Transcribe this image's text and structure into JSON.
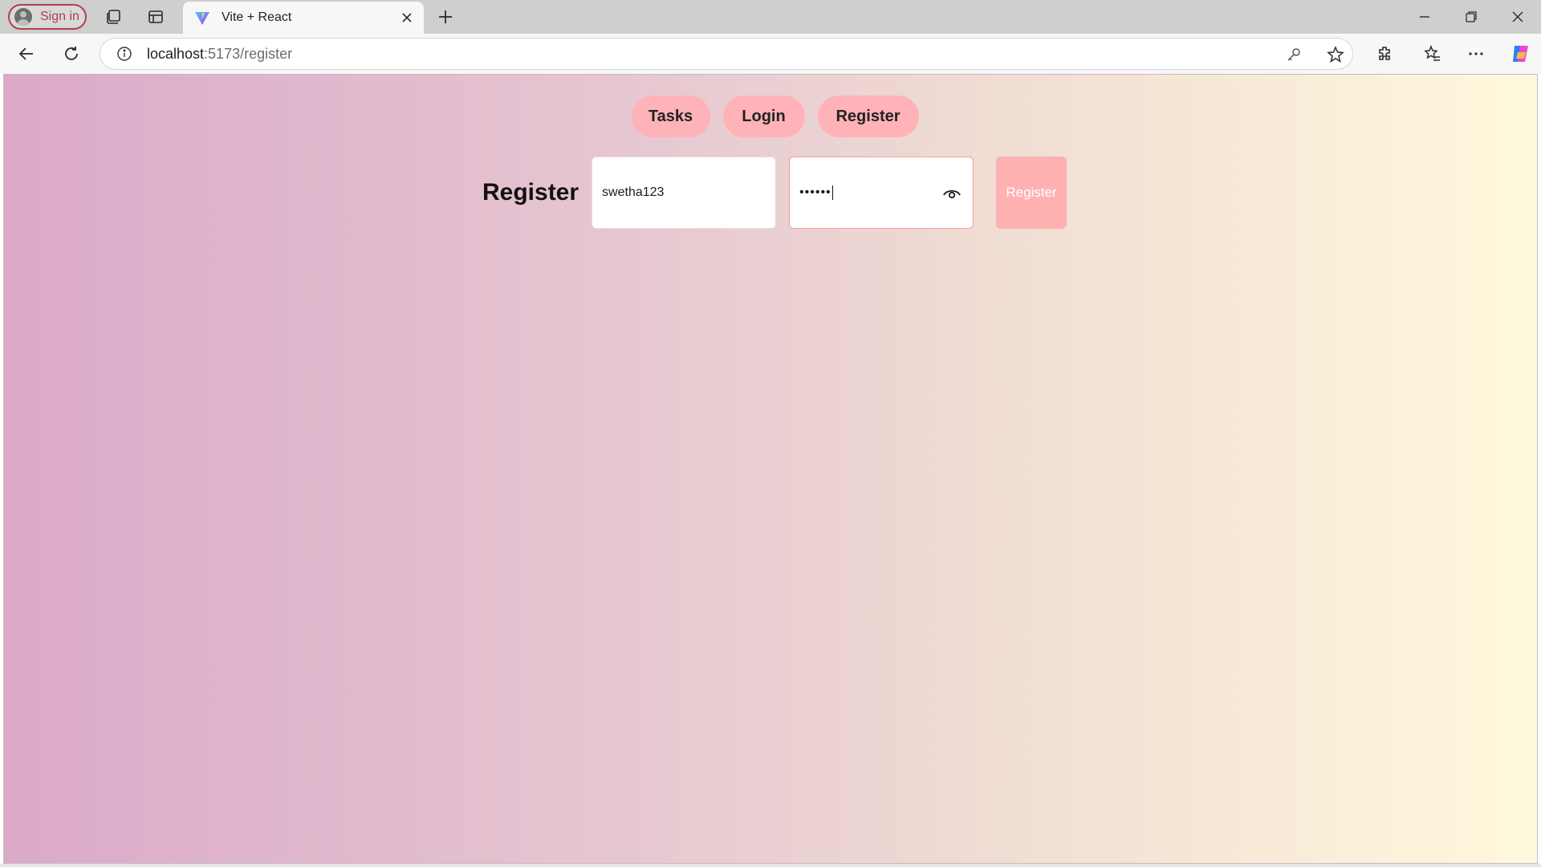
{
  "browser": {
    "profile_label": "Sign in",
    "tab_title": "Vite + React",
    "url_host": "localhost",
    "url_path": ":5173/register",
    "icons": [
      "person-icon",
      "workspaces-icon",
      "tab-actions-icon",
      "vite-favicon-icon",
      "close-icon",
      "new-tab-icon",
      "minimize-icon",
      "restore-icon",
      "window-close-icon",
      "back-icon",
      "refresh-icon",
      "info-icon",
      "key-icon",
      "star-icon",
      "extensions-icon",
      "favorites-icon",
      "more-icon",
      "copilot-icon"
    ]
  },
  "nav": {
    "tasks": "Tasks",
    "login": "Login",
    "register": "Register"
  },
  "form": {
    "heading": "Register",
    "username_value": "swetha123",
    "password_masked": "••••••",
    "submit_label": "Register"
  },
  "colors": {
    "nav_button_bg": "#ffb3b8",
    "submit_bg": "#ffb0b0",
    "gradient_start": "#dba9c8",
    "gradient_end": "#fff9dc"
  }
}
